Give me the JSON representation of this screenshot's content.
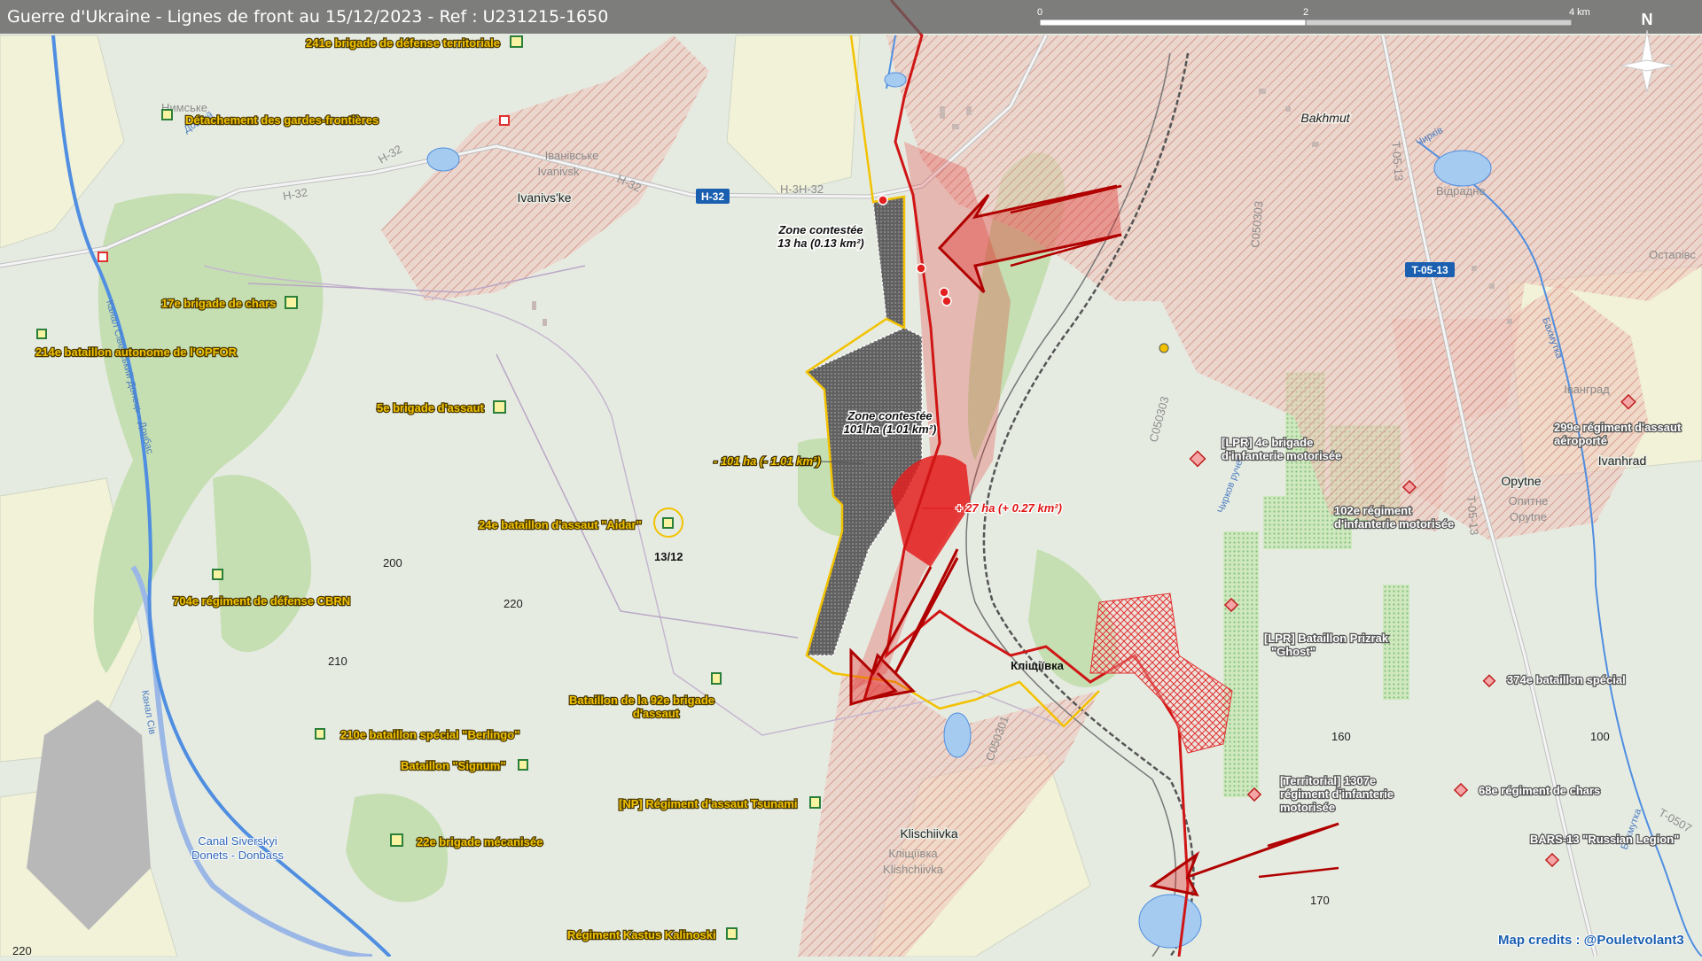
{
  "title": "Guerre d'Ukraine - Lignes de front au 15/12/2023 - Ref : U231215-1650",
  "scale": {
    "labels": [
      "0",
      "2",
      "4 km"
    ]
  },
  "north_label": "N",
  "towns": {
    "bakhmut": "Bakhmut",
    "ivanivske_en": "Ivanivs'ke",
    "ivanivske_ua": "Іванівське",
    "ivanivske_ua2": "Ivanivsk",
    "opytne": "Opytne",
    "opytne_ua": "Опитне",
    "opytne_en2": "Opytne",
    "ivanhrad": "Ivanhrad",
    "ivanhrad_ua": "Іванград",
    "klischiivka": "Klischiivka",
    "klischiivka_ua": "Кліщіївка",
    "klischiivka_en2": "Klishchiivka",
    "klischiivka_top": "Кліщіївка",
    "nymske": "Нимське",
    "ostapivske": "Остапівс",
    "vidrady": "Відрадне"
  },
  "roads": {
    "h32": "H-32",
    "h32_line": "H-3H-32",
    "t0513": "T-05-13",
    "c050303": "C050303",
    "c050303b": "C050303",
    "c050301": "C050301",
    "t0513_line": "T-05-13",
    "t0513_line2": "T-05-13",
    "h32_small1": "H-32",
    "h32_small2": "H-32",
    "h32_small3": "H-32",
    "t0507": "T-0507"
  },
  "water": {
    "canal": "Canal Siverskyi",
    "canal2": "Donets - Donbass",
    "dovhyi": "Довгий",
    "chyrkiv": "Чирків",
    "ruchei": "Чирков ручей",
    "bakhmutka": "Бахмутка",
    "canal_ua": "Канал Сіверський Донець - Донбас",
    "canal_ua2": "Канал Сів",
    "bakhmutka2": "Бахмутка"
  },
  "units": {
    "u1": "241e brigade de défense territoriale",
    "u2": "Détachement des gardes-frontières",
    "u3": "17e brigade de chars",
    "u4": "214e bataillon autonome de l'OPFOR",
    "u5": "5e brigade d'assaut",
    "u6": "24e bataillon d'assaut \"Aidar\"",
    "u6_date": "13/12",
    "u7": "704e régiment de défense CBRN",
    "u8a": "Bataillon de la 92e brigade",
    "u8b": "d'assaut",
    "u9": "210e bataillon spécial \"Berlingo\"",
    "u10": "Bataillon \"Signum\"",
    "u11": "[NP] Régiment d'assaut Tsunami",
    "u12": "22e brigade mécanisée",
    "u13": "Régiment Kastus Kalinoski"
  },
  "ru_units": {
    "r1a": "[LPR] 4e brigade",
    "r1b": "d'infanterie motorisée",
    "r2a": "102e régiment",
    "r2b": "d'infanterie motorisée",
    "r3a": "[LPR] Bataillon Prizrak",
    "r3b": "\"Ghost\"",
    "r4a": "[Territorial] 1307e",
    "r4b": "régiment d'infanterie",
    "r4c": "motorisée",
    "r5": "374e bataillon spécial",
    "r6": "68e régiment de chars",
    "r7": "BARS-13 \"Russian Legion\"",
    "r8a": "299e régiment d'assaut",
    "r8b": "aéroporté"
  },
  "zones": {
    "z1a": "Zone contestée",
    "z1b": "13 ha (0.13 km²)",
    "z2a": "Zone contestée",
    "z2b": "101 ha (1.01 km²)",
    "loss": "- 101 ha (- 1.01 km²)",
    "gain": "+ 27 ha (+ 0.27 km²)"
  },
  "elevations": [
    "200",
    "220",
    "210",
    "160",
    "100",
    "170",
    "220"
  ],
  "credits": "Map credits : @Pouletvolant3",
  "colors": {
    "russian_occupied": "#e8b3aa",
    "russian_advance": "#e32020",
    "ukraine_line": "#f2c200",
    "contested": "#555555",
    "forest": "#c5dfb2",
    "road_shield": "#1a5fb0"
  }
}
